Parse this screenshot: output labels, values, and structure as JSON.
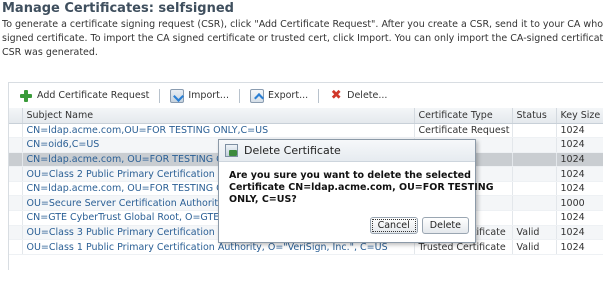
{
  "page": {
    "title": "Manage Certificates: selfsigned",
    "description_lines": [
      "To generate a certificate signing request (CSR), click \"Add Certificate Request\". After you create a CSR, send it to your CA who",
      "signed certificate. To import the CA signed certificate or trusted cert, click Import. You can only import the CA-signed certificate",
      "CSR was generated."
    ]
  },
  "toolbar": {
    "add_label": "Add Certificate Request",
    "import_label": "Import...",
    "export_label": "Export...",
    "delete_label": "Delete..."
  },
  "table": {
    "headers": [
      "Subject Name",
      "Certificate Type",
      "Status",
      "Key Size"
    ],
    "rows": [
      {
        "subject": "CN=ldap.acme.com,OU=FOR TESTING ONLY,C=US",
        "type": "Certificate Request",
        "status": "",
        "key": "1024"
      },
      {
        "subject": "CN=oid6,C=US",
        "type": "",
        "status": "",
        "key": "1024"
      },
      {
        "subject": "CN=ldap.acme.com, OU=FOR TESTING ONLY, C=US",
        "type": "",
        "status": "",
        "key": "1024"
      },
      {
        "subject": "OU=Class 2 Public Primary Certification Authority",
        "type": "",
        "status": "",
        "key": "1024"
      },
      {
        "subject": "CN=ldap.acme.com, OU=FOR TESTING ONLY, C=US",
        "type": "",
        "status": "",
        "key": "1024"
      },
      {
        "subject": "OU=Secure Server Certification Authority",
        "type": "",
        "status": "",
        "key": "1000"
      },
      {
        "subject": "CN=GTE CyberTrust Global Root, O=GTE Corporation",
        "type": "",
        "status": "",
        "key": "1024"
      },
      {
        "subject": "OU=Class 3 Public Primary Certification Authority, O=\"VeriSign, Inc.\", C=US",
        "type": "Trusted Certificate",
        "status": "Valid",
        "key": "1024"
      },
      {
        "subject": "OU=Class 1 Public Primary Certification Authority, O=\"VeriSign, Inc.\", C=US",
        "type": "Trusted Certificate",
        "status": "Valid",
        "key": "1024"
      }
    ]
  },
  "dialog": {
    "title": "Delete Certificate",
    "message_lines": [
      "Are you sure you want to delete the selected",
      "Certificate CN=ldap.acme.com, OU=FOR TESTING",
      "ONLY, C=US?"
    ],
    "cancel_label": "Cancel",
    "delete_label": "Delete"
  }
}
